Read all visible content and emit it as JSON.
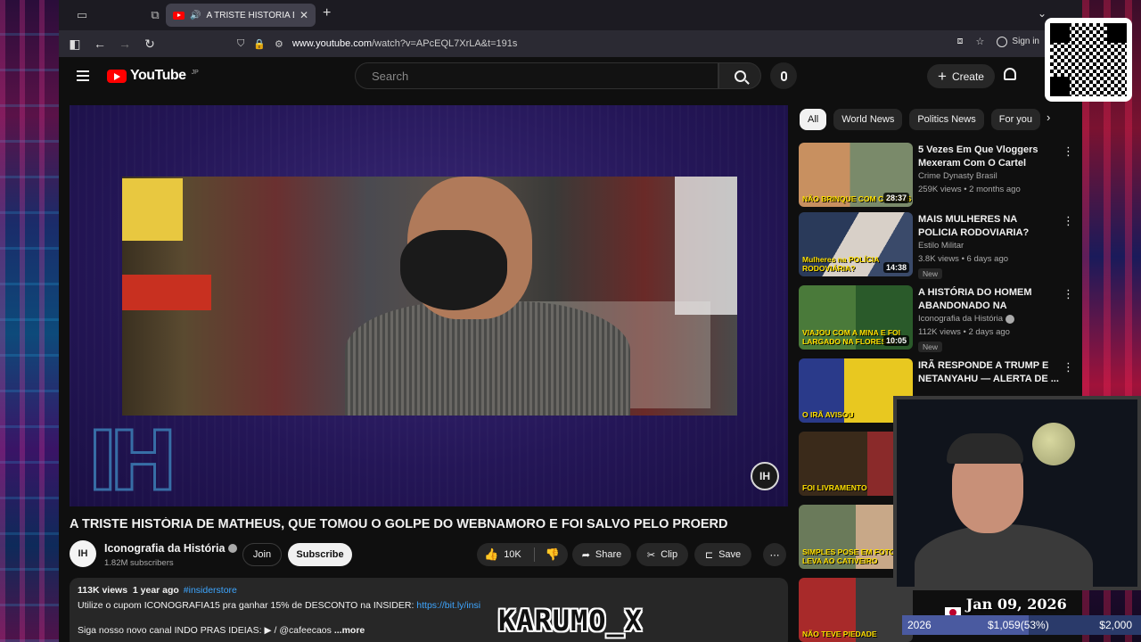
{
  "browser": {
    "tab_title": "A TRISTE HISTÓRIA DE MATHEUS",
    "url_host": "www.youtube.com",
    "url_path": "/watch?v=APcEQL7XrLA&t=191s",
    "sign_in": "Sign in"
  },
  "header": {
    "logo": "YouTube",
    "region": "JP",
    "search_placeholder": "Search",
    "create_label": "Create"
  },
  "video": {
    "title": "A TRISTE HISTÓRIA DE MATHEUS, QUE TOMOU O GOLPE DO WEBNAMORO E FOI SALVO PELO PROERD",
    "channel": "Iconografia da História",
    "channel_initials": "IH",
    "subscribers": "1.82M subscribers",
    "join": "Join",
    "subscribe": "Subscribe",
    "likes": "10K",
    "share": "Share",
    "clip": "Clip",
    "save": "Save"
  },
  "description": {
    "views": "113K views",
    "age": "1 year ago",
    "hashtag": "#insiderstore",
    "line1": "Utilize o cupom ICONOGRAFIA15 pra ganhar 15% de DESCONTO na INSIDER:",
    "line1_link": "https://bit.ly/insi",
    "line2": "Siga nosso novo canal INDO PRAS IDEIAS:",
    "line2_handle": "/ @cafeecaos",
    "more": "...more"
  },
  "chips": [
    "All",
    "World News",
    "Politics News",
    "For you"
  ],
  "recommendations": [
    {
      "title": "5 Vezes Em Que Vloggers Mexeram Com O Cartel Errado",
      "channel": "Crime Dynasty Brasil",
      "stats": "259K views • 2 months ago",
      "duration": "28:37",
      "caption": "NÃO BRINQUE COM CARTÉIS",
      "new": ""
    },
    {
      "title": "MAIS MULHERES NA POLICIA RODOVIARIA?",
      "channel": "Estilo Militar",
      "stats": "3.8K views • 6 days ago",
      "duration": "14:38",
      "caption": "Mulheres na POLÍCIA RODOVIÁRIA?",
      "new": "New"
    },
    {
      "title": "A HISTÓRIA DO HOMEM ABANDONADO NA MONTANH...",
      "channel": "Iconografia da História",
      "stats": "112K views • 2 days ago",
      "duration": "10:05",
      "caption": "VIAJOU COM A MINA E FOI LARGADO NA FLORESTA",
      "new": "New"
    },
    {
      "title": "IRÃ RESPONDE A TRUMP E NETANYAHU — ALERTA DE ...",
      "channel": "",
      "stats": "",
      "duration": "",
      "caption": "O IRÃ AVISOU",
      "new": ""
    },
    {
      "title": "",
      "channel": "",
      "stats": "",
      "duration": "",
      "caption": "FOI LIVRAMENTO",
      "new": ""
    },
    {
      "title": "",
      "channel": "",
      "stats": "",
      "duration": "",
      "caption": "SIMPLES POSE EM FOTO LEVA AO CATIVEIRO",
      "new": ""
    },
    {
      "title": "",
      "channel": "",
      "stats": "",
      "duration": "",
      "caption": "NÃO TEVE PIEDADE",
      "new": ""
    }
  ],
  "overlay": {
    "streamer_name": "KARUMO_X",
    "datetime": "Jan 09, 2026 09:04AM",
    "goal_year": "2026",
    "goal_current": "$1,059(53%)",
    "goal_target": "$2,000",
    "goal_progress": 0.53
  },
  "icons": {
    "back": "arrow-left-icon",
    "forward": "arrow-right-icon",
    "reload": "reload-icon",
    "bell": "bell-icon",
    "mic": "mic-icon"
  }
}
